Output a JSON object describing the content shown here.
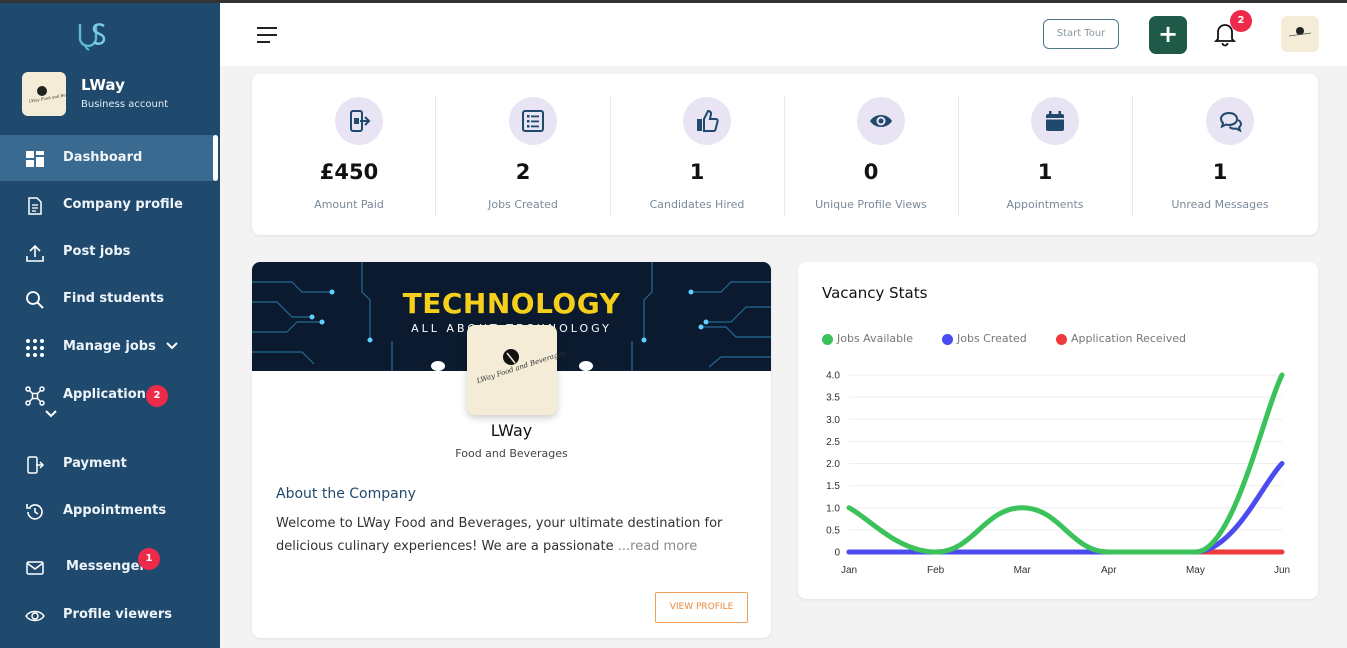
{
  "brand": {
    "logo_text": "US"
  },
  "account": {
    "name": "LWay",
    "type": "Business account"
  },
  "sidebar": {
    "items": [
      {
        "label": "Dashboard",
        "icon": "dashboard-icon"
      },
      {
        "label": "Company profile",
        "icon": "document-icon"
      },
      {
        "label": "Post jobs",
        "icon": "upload-icon"
      },
      {
        "label": "Find students",
        "icon": "search-icon"
      },
      {
        "label": "Manage jobs",
        "icon": "grid-icon"
      },
      {
        "label": "Applications",
        "icon": "network-icon",
        "badge": "2"
      },
      {
        "label": "Payment",
        "icon": "payment-icon"
      },
      {
        "label": "Appointments",
        "icon": "history-icon"
      },
      {
        "label": "Messenger",
        "icon": "mail-icon",
        "badge": "1"
      },
      {
        "label": "Profile viewers",
        "icon": "eye-icon"
      }
    ]
  },
  "header": {
    "start_tour": "Start Tour",
    "plus": "+",
    "notifications": "2"
  },
  "stats": [
    {
      "value": "£450",
      "label": "Amount Paid",
      "icon": "payment-icon"
    },
    {
      "value": "2",
      "label": "Jobs Created",
      "icon": "list-icon"
    },
    {
      "value": "1",
      "label": "Candidates Hired",
      "icon": "thumbs-up-icon"
    },
    {
      "value": "0",
      "label": "Unique Profile Views",
      "icon": "eye-icon"
    },
    {
      "value": "1",
      "label": "Appointments",
      "icon": "calendar-icon"
    },
    {
      "value": "1",
      "label": "Unread Messages",
      "icon": "chat-icon"
    }
  ],
  "company": {
    "banner_title": "TECHNOLOGY",
    "banner_subtitle": "ALL ABOUT TECHNOLOGY",
    "logo_text": "LWay Food and Beverages",
    "name": "LWay",
    "category": "Food and Beverages",
    "about_heading": "About the Company",
    "about_text": "Welcome to LWay Food and Beverages, your ultimate destination for delicious culinary experiences! We are a passionate ",
    "read_more": "...read more",
    "view_profile": "VIEW PROFILE"
  },
  "colors": {
    "sidebar": "#1f4a6e",
    "green": "#3cc25a",
    "blue": "#4b4cf0",
    "red": "#ee3a3a"
  },
  "chart_data": {
    "type": "line",
    "title": "Vacancy Stats",
    "categories": [
      "Jan",
      "Feb",
      "Mar",
      "Apr",
      "May",
      "Jun"
    ],
    "series": [
      {
        "name": "Jobs Available",
        "color": "#3cc25a",
        "values": [
          1,
          0,
          1,
          0,
          0,
          4
        ]
      },
      {
        "name": "Jobs Created",
        "color": "#4b4cf0",
        "values": [
          0,
          0,
          0,
          0,
          0,
          2
        ]
      },
      {
        "name": "Application Received",
        "color": "#ee3a3a",
        "values": [
          0,
          0,
          0,
          0,
          0,
          0
        ]
      }
    ],
    "yticks": [
      "0",
      "0.5",
      "1.0",
      "1.5",
      "2.0",
      "2.5",
      "3.0",
      "3.5",
      "4.0"
    ],
    "ylim": [
      0,
      4
    ],
    "legend_position": "top-left",
    "grid": true
  }
}
